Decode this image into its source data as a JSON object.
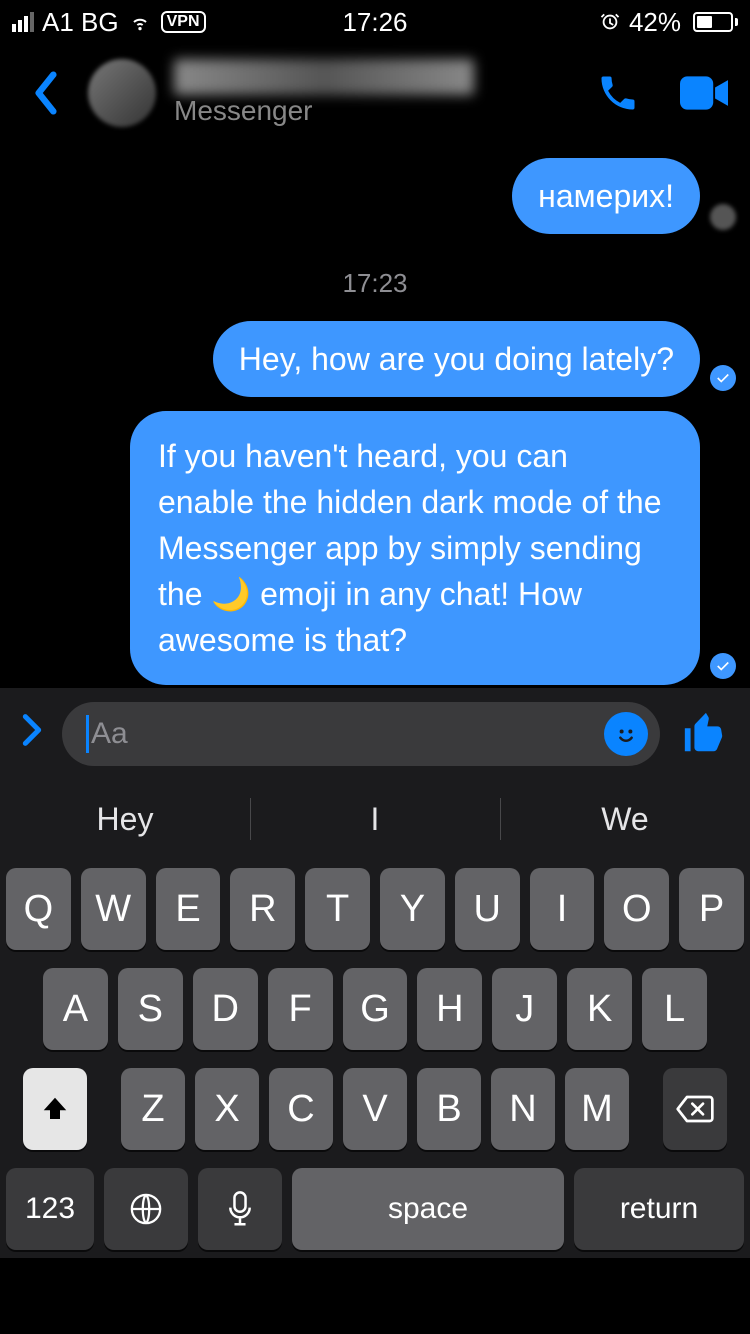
{
  "status": {
    "carrier": "A1 BG",
    "vpn": "VPN",
    "time": "17:26",
    "battery_pct": "42%"
  },
  "nav": {
    "subtitle": "Messenger"
  },
  "chat": {
    "msg0": "намерих!",
    "timestamp": "17:23",
    "msg1": "Hey, how are you doing lately?",
    "msg2": "If you haven't heard, you can enable the hidden dark mode of the Messenger app by simply sending the 🌙 emoji in any chat! How awesome is that?"
  },
  "composer": {
    "placeholder": "Aa"
  },
  "suggestions": [
    "Hey",
    "I",
    "We"
  ],
  "keyboard": {
    "r1": [
      "Q",
      "W",
      "E",
      "R",
      "T",
      "Y",
      "U",
      "I",
      "O",
      "P"
    ],
    "r2": [
      "A",
      "S",
      "D",
      "F",
      "G",
      "H",
      "J",
      "K",
      "L"
    ],
    "r3": [
      "Z",
      "X",
      "C",
      "V",
      "B",
      "N",
      "M"
    ],
    "num": "123",
    "space": "space",
    "return": "return"
  }
}
